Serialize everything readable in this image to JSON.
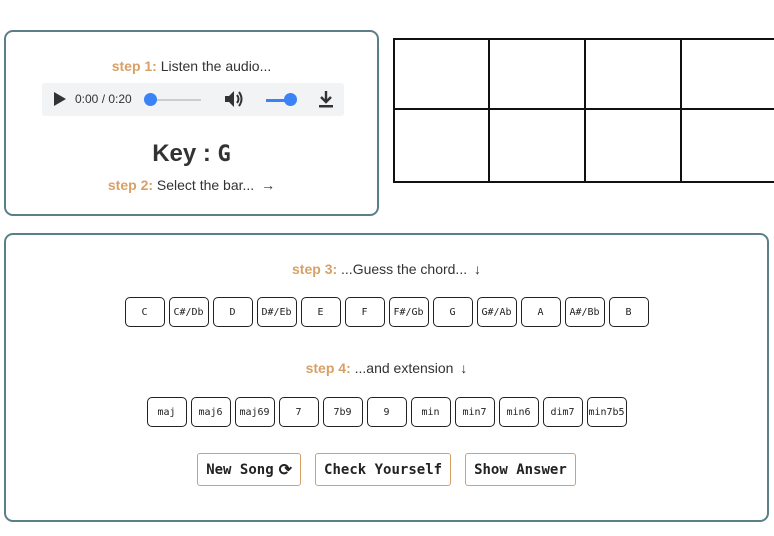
{
  "step1": {
    "label": "step 1:",
    "text": "Listen the audio..."
  },
  "audio": {
    "time": "0:00 / 0:20",
    "progress": 0.0,
    "volume": 1.0
  },
  "key": {
    "label": "Key :",
    "value": "G"
  },
  "step2": {
    "label": "step 2:",
    "text": "Select the bar...",
    "arrow": "→"
  },
  "step3": {
    "label": "step 3:",
    "text": "...Guess the chord...",
    "arrow": "↓"
  },
  "roots": [
    "C",
    "C#/Db",
    "D",
    "D#/Eb",
    "E",
    "F",
    "F#/Gb",
    "G",
    "G#/Ab",
    "A",
    "A#/Bb",
    "B"
  ],
  "step4": {
    "label": "step 4:",
    "text": "...and extension",
    "arrow": "↓"
  },
  "extensions": [
    "maj",
    "maj6",
    "maj69",
    "7",
    "7b9",
    "9",
    "min",
    "min7",
    "min6",
    "dim7",
    "min7b5"
  ],
  "actions": {
    "new_song": "New Song",
    "check": "Check Yourself",
    "show": "Show Answer"
  },
  "icons": {
    "play": "play-icon",
    "volume": "volume-icon",
    "download": "download-icon",
    "refresh": "refresh-icon"
  },
  "colors": {
    "step_accent": "#d9a066",
    "panel_border": "#5b7f86",
    "slider": "#3b82f6"
  }
}
